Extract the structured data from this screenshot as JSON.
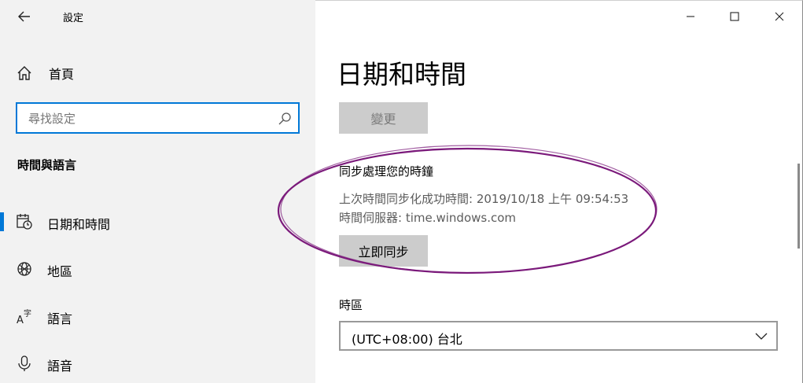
{
  "window": {
    "app_title": "設定",
    "back_icon": "back-arrow-icon",
    "minimize_icon": "minimize-icon",
    "maximize_icon": "maximize-icon",
    "close_icon": "close-icon"
  },
  "sidebar": {
    "home": {
      "label": "首頁",
      "icon": "home-icon"
    },
    "search": {
      "placeholder": "尋找設定",
      "icon": "search-icon"
    },
    "section_title": "時間與語言",
    "items": [
      {
        "label": "日期和時間",
        "icon": "calendar-clock-icon",
        "selected": true
      },
      {
        "label": "地區",
        "icon": "globe-icon",
        "selected": false
      },
      {
        "label": "語言",
        "icon": "language-icon",
        "selected": false
      },
      {
        "label": "語音",
        "icon": "microphone-icon",
        "selected": false
      }
    ],
    "accent_color": "#0078d7"
  },
  "main": {
    "page_title": "日期和時間",
    "change_button": "變更",
    "sync": {
      "title": "同步處理您的時鐘",
      "last_sync": "上次時間同步化成功時間: 2019/10/18 上午 09:54:53",
      "time_server": "時間伺服器: time.windows.com",
      "sync_button": "立即同步"
    },
    "timezone": {
      "label": "時區",
      "selected": "(UTC+08:00) 台北",
      "icon": "chevron-down-icon"
    }
  },
  "annotation": {
    "color": "#7b1a7b"
  }
}
